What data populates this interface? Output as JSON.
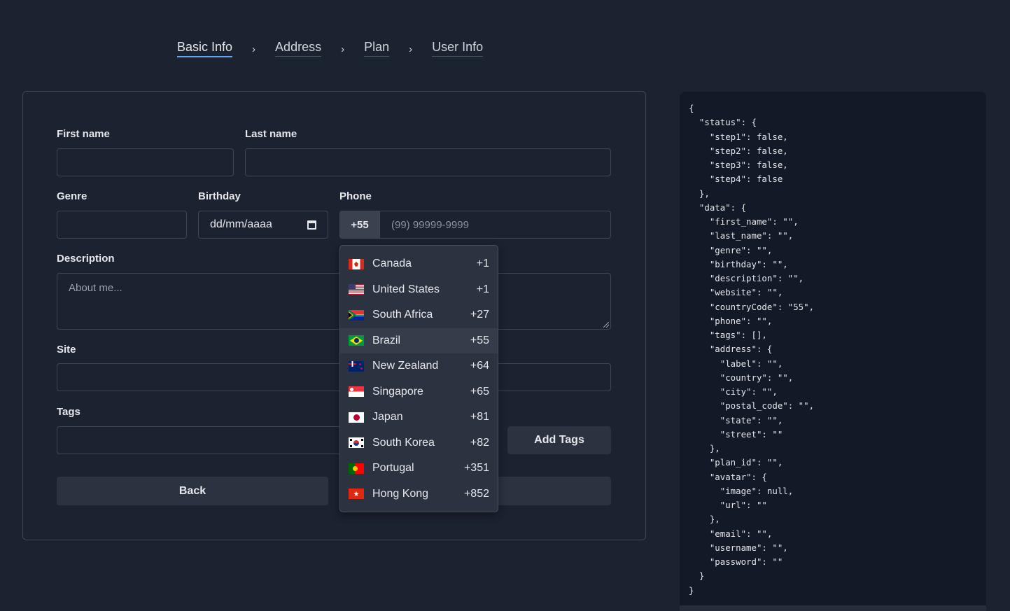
{
  "stepper": {
    "steps": [
      "Basic Info",
      "Address",
      "Plan",
      "User Info"
    ],
    "separator": "›"
  },
  "form": {
    "first_name_label": "First name",
    "last_name_label": "Last name",
    "genre_label": "Genre",
    "birthday_label": "Birthday",
    "birthday_placeholder": "dd/mm/aaaa",
    "phone_label": "Phone",
    "country_code": "+55",
    "phone_placeholder": "(99) 99999-9999",
    "description_label": "Description",
    "description_placeholder": "About me...",
    "site_label": "Site",
    "tags_label": "Tags",
    "add_tags_button": "Add Tags",
    "back_button": "Back"
  },
  "country_dropdown": {
    "selected": "Brazil",
    "options": [
      {
        "name": "Canada",
        "code": "+1",
        "flag": "canada-flag-icon"
      },
      {
        "name": "United States",
        "code": "+1",
        "flag": "us-flag-icon"
      },
      {
        "name": "South Africa",
        "code": "+27",
        "flag": "south-africa-flag-icon"
      },
      {
        "name": "Brazil",
        "code": "+55",
        "flag": "brazil-flag-icon"
      },
      {
        "name": "New Zealand",
        "code": "+64",
        "flag": "new-zealand-flag-icon"
      },
      {
        "name": "Singapore",
        "code": "+65",
        "flag": "singapore-flag-icon"
      },
      {
        "name": "Japan",
        "code": "+81",
        "flag": "japan-flag-icon"
      },
      {
        "name": "South Korea",
        "code": "+82",
        "flag": "south-korea-flag-icon"
      },
      {
        "name": "Portugal",
        "code": "+351",
        "flag": "portugal-flag-icon"
      },
      {
        "name": "Hong Kong",
        "code": "+852",
        "flag": "hong-kong-flag-icon"
      }
    ]
  },
  "json_preview": "{\n  \"status\": {\n    \"step1\": false,\n    \"step2\": false,\n    \"step3\": false,\n    \"step4\": false\n  },\n  \"data\": {\n    \"first_name\": \"\",\n    \"last_name\": \"\",\n    \"genre\": \"\",\n    \"birthday\": \"\",\n    \"description\": \"\",\n    \"website\": \"\",\n    \"countryCode\": \"55\",\n    \"phone\": \"\",\n    \"tags\": [],\n    \"address\": {\n      \"label\": \"\",\n      \"country\": \"\",\n      \"city\": \"\",\n      \"postal_code\": \"\",\n      \"state\": \"\",\n      \"street\": \"\"\n    },\n    \"plan_id\": \"\",\n    \"avatar\": {\n      \"image\": null,\n      \"url\": \"\"\n    },\n    \"email\": \"\",\n    \"username\": \"\",\n    \"password\": \"\"\n  }\n}",
  "colors": {
    "background": "#1b2230",
    "accent": "#60a5fa",
    "panel": "#131a27"
  }
}
